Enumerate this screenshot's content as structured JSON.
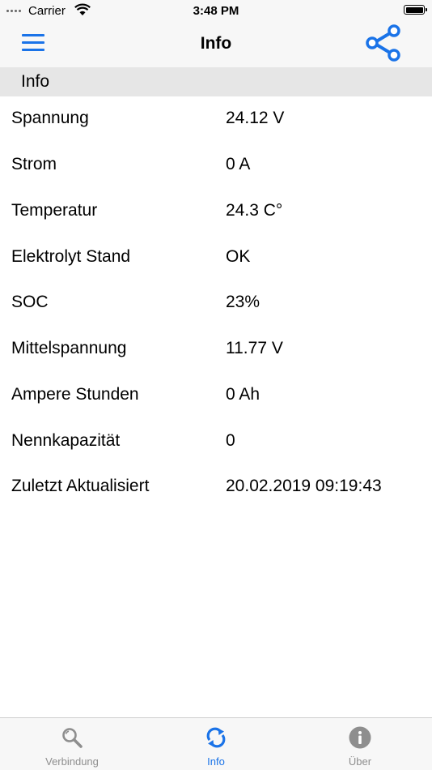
{
  "status_bar": {
    "carrier": "Carrier",
    "time": "3:48 PM"
  },
  "nav": {
    "title": "Info",
    "left_icon": "hamburger-menu-icon",
    "right_icon": "share-icon"
  },
  "section": {
    "title": "Info"
  },
  "rows": [
    {
      "label": "Spannung",
      "value": "24.12 V"
    },
    {
      "label": "Strom",
      "value": "0 A"
    },
    {
      "label": "Temperatur",
      "value": "24.3 C°"
    },
    {
      "label": "Elektrolyt Stand",
      "value": "OK"
    },
    {
      "label": "SOC",
      "value": "23%"
    },
    {
      "label": "Mittelspannung",
      "value": "11.77 V"
    },
    {
      "label": "Ampere Stunden",
      "value": "0 Ah"
    },
    {
      "label": "Nennkapazität",
      "value": "0"
    },
    {
      "label": "Zuletzt Aktualisiert",
      "value": "20.02.2019 09:19:43"
    }
  ],
  "tabs": [
    {
      "label": "Verbindung",
      "icon": "search-icon",
      "active": false
    },
    {
      "label": "Info",
      "icon": "refresh-icon",
      "active": true
    },
    {
      "label": "Über",
      "icon": "info-icon",
      "active": false
    }
  ],
  "colors": {
    "accent": "#1a73e8",
    "inactive": "#8e8e8e",
    "bar_background": "#f7f7f7",
    "section_background": "#e6e6e6"
  }
}
